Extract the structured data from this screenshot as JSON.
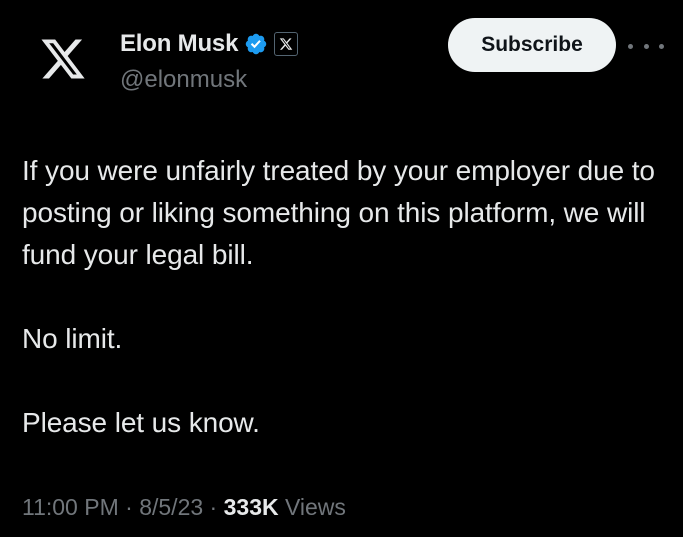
{
  "author": {
    "display_name": "Elon Musk",
    "handle": "@elonmusk",
    "avatar_icon": "x-logo-icon",
    "verified_icon": "verified-badge-icon",
    "affiliate_icon": "x-affiliate-badge-icon"
  },
  "actions": {
    "subscribe_label": "Subscribe",
    "more_icon": "more-options-icon"
  },
  "tweet": {
    "line1": "If you were unfairly treated by your employer due to posting or liking something on this platform, we will fund your legal bill.",
    "line2": "No limit.",
    "line3": "Please let us know."
  },
  "meta": {
    "time": "11:00 PM",
    "sep1": " · ",
    "date": "8/5/23",
    "sep2": " · ",
    "views_count": "333K",
    "views_label": " Views"
  },
  "colors": {
    "background": "#000000",
    "text_primary": "#e7e9ea",
    "text_secondary": "#71767b",
    "verified_blue": "#1d9bf0",
    "button_bg": "#eff3f4"
  }
}
